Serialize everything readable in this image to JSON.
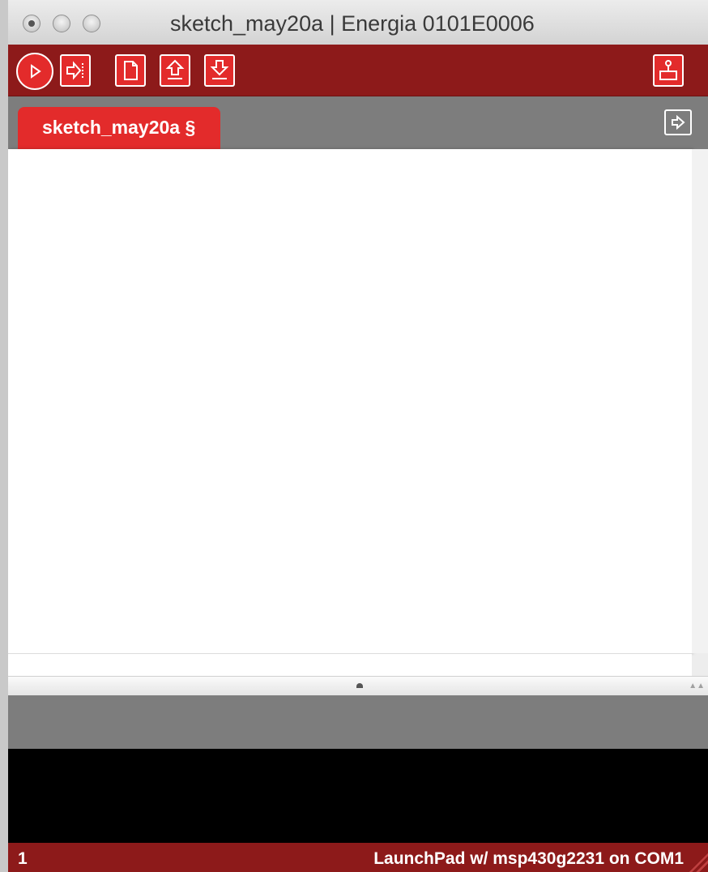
{
  "window": {
    "title": "sketch_may20a | Energia 0101E0006"
  },
  "toolbar": {
    "buttons": [
      {
        "name": "verify",
        "icon": "play-icon"
      },
      {
        "name": "upload",
        "icon": "arrow-right-icon"
      },
      {
        "name": "new",
        "icon": "document-icon"
      },
      {
        "name": "open",
        "icon": "arrow-up-icon"
      },
      {
        "name": "save",
        "icon": "arrow-down-icon"
      },
      {
        "name": "serial-monitor",
        "icon": "serial-monitor-icon"
      }
    ]
  },
  "tabs": [
    {
      "label": "sketch_may20a §",
      "active": true
    }
  ],
  "editor": {
    "content": ""
  },
  "status": {
    "line_number": "1",
    "board": "LaunchPad w/ msp430g2231 on COM1"
  },
  "colors": {
    "toolbar_bg": "#8d1a1a",
    "accent": "#e32b2b",
    "tabbar_bg": "#7d7d7d",
    "console_bg": "#000000"
  }
}
